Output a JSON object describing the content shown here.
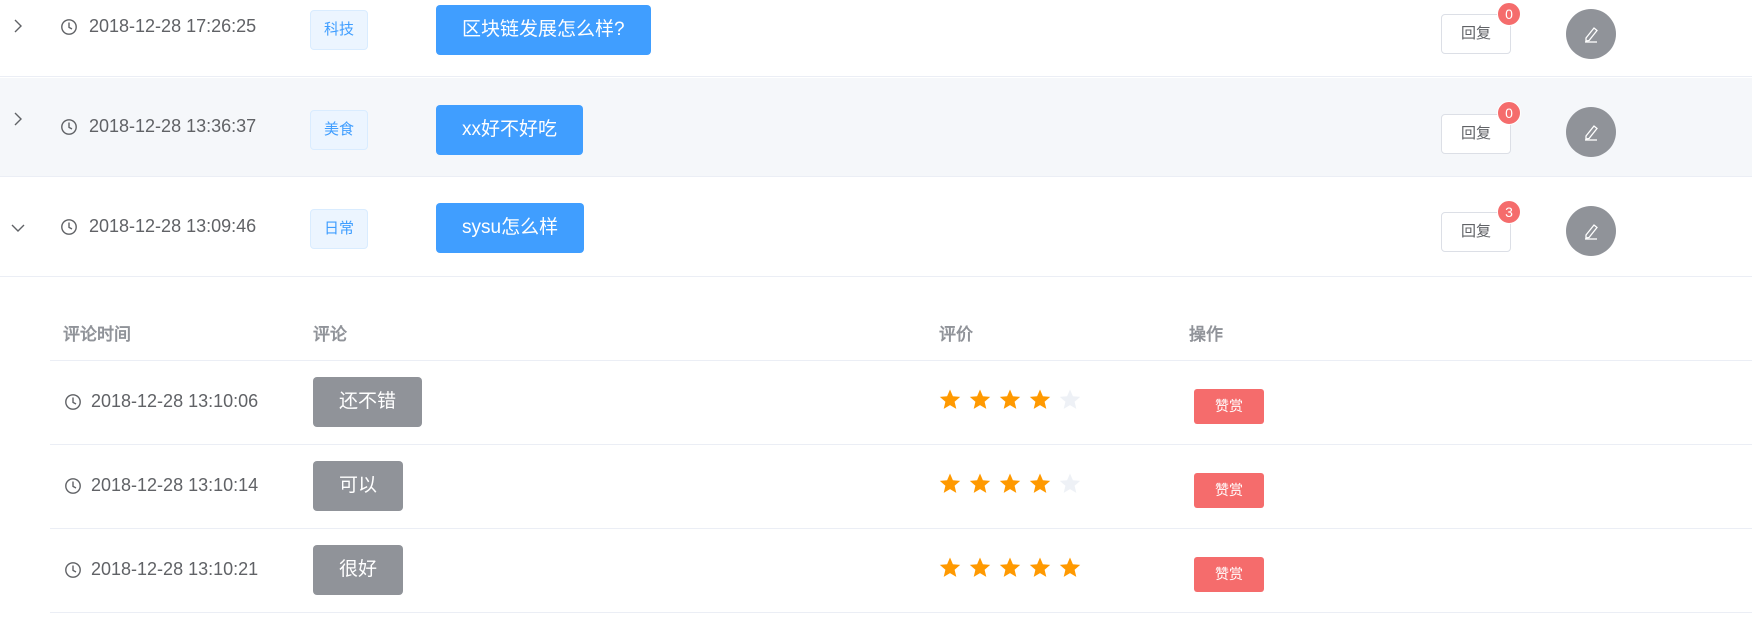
{
  "colors": {
    "primary": "#409eff",
    "danger": "#f56c6c",
    "info": "#909399",
    "star_on": "#ff9900",
    "star_off": "#eef1f6",
    "row_hover_bg": "#f5f7fa"
  },
  "questions": [
    {
      "time": "2018-12-28 17:26:25",
      "tag": "科技",
      "title": "区块链发展怎么样?",
      "reply_label": "回复",
      "reply_count": "0",
      "expanded": false,
      "icon": "chevron-right-icon"
    },
    {
      "time": "2018-12-28 13:36:37",
      "tag": "美食",
      "title": "xx好不好吃",
      "reply_label": "回复",
      "reply_count": "0",
      "expanded": false,
      "icon": "chevron-right-icon"
    },
    {
      "time": "2018-12-28 13:09:46",
      "tag": "日常",
      "title": "sysu怎么样",
      "reply_label": "回复",
      "reply_count": "3",
      "expanded": true,
      "icon": "chevron-down-icon"
    }
  ],
  "comments_table": {
    "headers": {
      "time": "评论时间",
      "comment": "评论",
      "rating": "评价",
      "action": "操作"
    },
    "rows": [
      {
        "time": "2018-12-28 13:10:06",
        "comment": "还不错",
        "rating": 4,
        "max_rating": 5,
        "action_label": "赞赏"
      },
      {
        "time": "2018-12-28 13:10:14",
        "comment": "可以",
        "rating": 4,
        "max_rating": 5,
        "action_label": "赞赏"
      },
      {
        "time": "2018-12-28 13:10:21",
        "comment": "很好",
        "rating": 5,
        "max_rating": 5,
        "action_label": "赞赏"
      }
    ]
  }
}
